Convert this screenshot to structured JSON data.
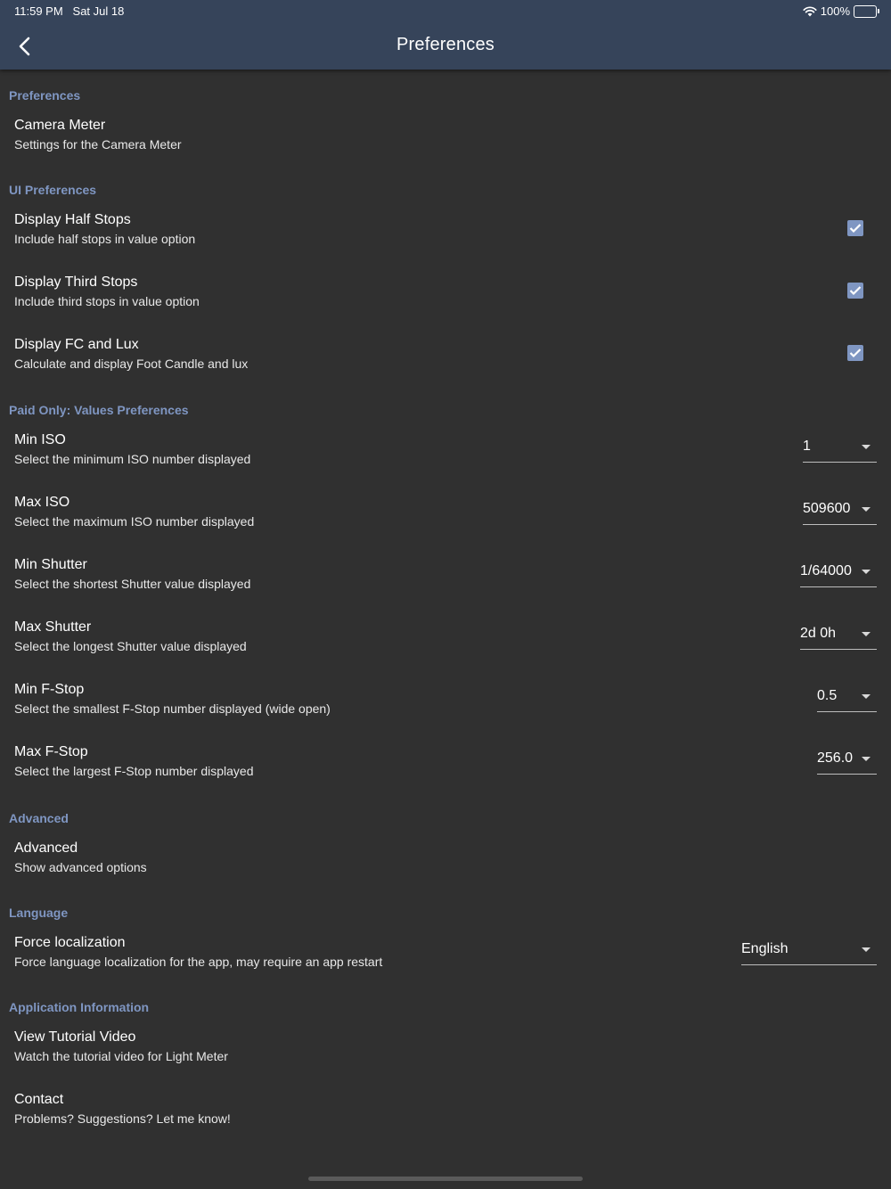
{
  "status_bar": {
    "time": "11:59 PM",
    "date": "Sat Jul 18",
    "battery": "100%"
  },
  "app_bar": {
    "title": "Preferences",
    "back_icon": "chevron-left-icon"
  },
  "colors": {
    "app_bar": "#36445a",
    "accent": "#7f96c2",
    "background": "#303030"
  },
  "sections": {
    "preferences": {
      "header": "Preferences",
      "camera_meter": {
        "title": "Camera Meter",
        "subtitle": "Settings for the Camera Meter"
      }
    },
    "ui": {
      "header": "UI Preferences",
      "half_stops": {
        "title": "Display Half Stops",
        "subtitle": "Include half stops in value option",
        "checked": true
      },
      "third_stops": {
        "title": "Display Third Stops",
        "subtitle": "Include third stops in value option",
        "checked": true
      },
      "fc_lux": {
        "title": "Display FC and Lux",
        "subtitle": "Calculate and display Foot Candle and lux",
        "checked": true
      }
    },
    "values": {
      "header": "Paid Only: Values Preferences",
      "min_iso": {
        "title": "Min ISO",
        "subtitle": "Select the minimum ISO number displayed",
        "value": "1"
      },
      "max_iso": {
        "title": "Max ISO",
        "subtitle": "Select the maximum ISO number displayed",
        "value": "509600"
      },
      "min_shutter": {
        "title": "Min Shutter",
        "subtitle": "Select the shortest Shutter value displayed",
        "value": "1/64000"
      },
      "max_shutter": {
        "title": "Max Shutter",
        "subtitle": "Select the longest Shutter value displayed",
        "value": "2d 0h"
      },
      "min_fstop": {
        "title": "Min F-Stop",
        "subtitle": "Select the smallest F-Stop number displayed (wide open)",
        "value": "0.5"
      },
      "max_fstop": {
        "title": "Max F-Stop",
        "subtitle": "Select the largest F-Stop number displayed",
        "value": "256.0"
      }
    },
    "advanced": {
      "header": "Advanced",
      "advanced": {
        "title": "Advanced",
        "subtitle": "Show advanced options"
      }
    },
    "language": {
      "header": "Language",
      "force_localization": {
        "title": "Force localization",
        "subtitle": "Force language localization for the app, may require an app restart",
        "value": "English"
      }
    },
    "app_info": {
      "header": "Application Information",
      "tutorial": {
        "title": "View Tutorial Video",
        "subtitle": "Watch the tutorial video for Light Meter"
      },
      "contact": {
        "title": "Contact",
        "subtitle": "Problems? Suggestions? Let me know!"
      }
    }
  }
}
